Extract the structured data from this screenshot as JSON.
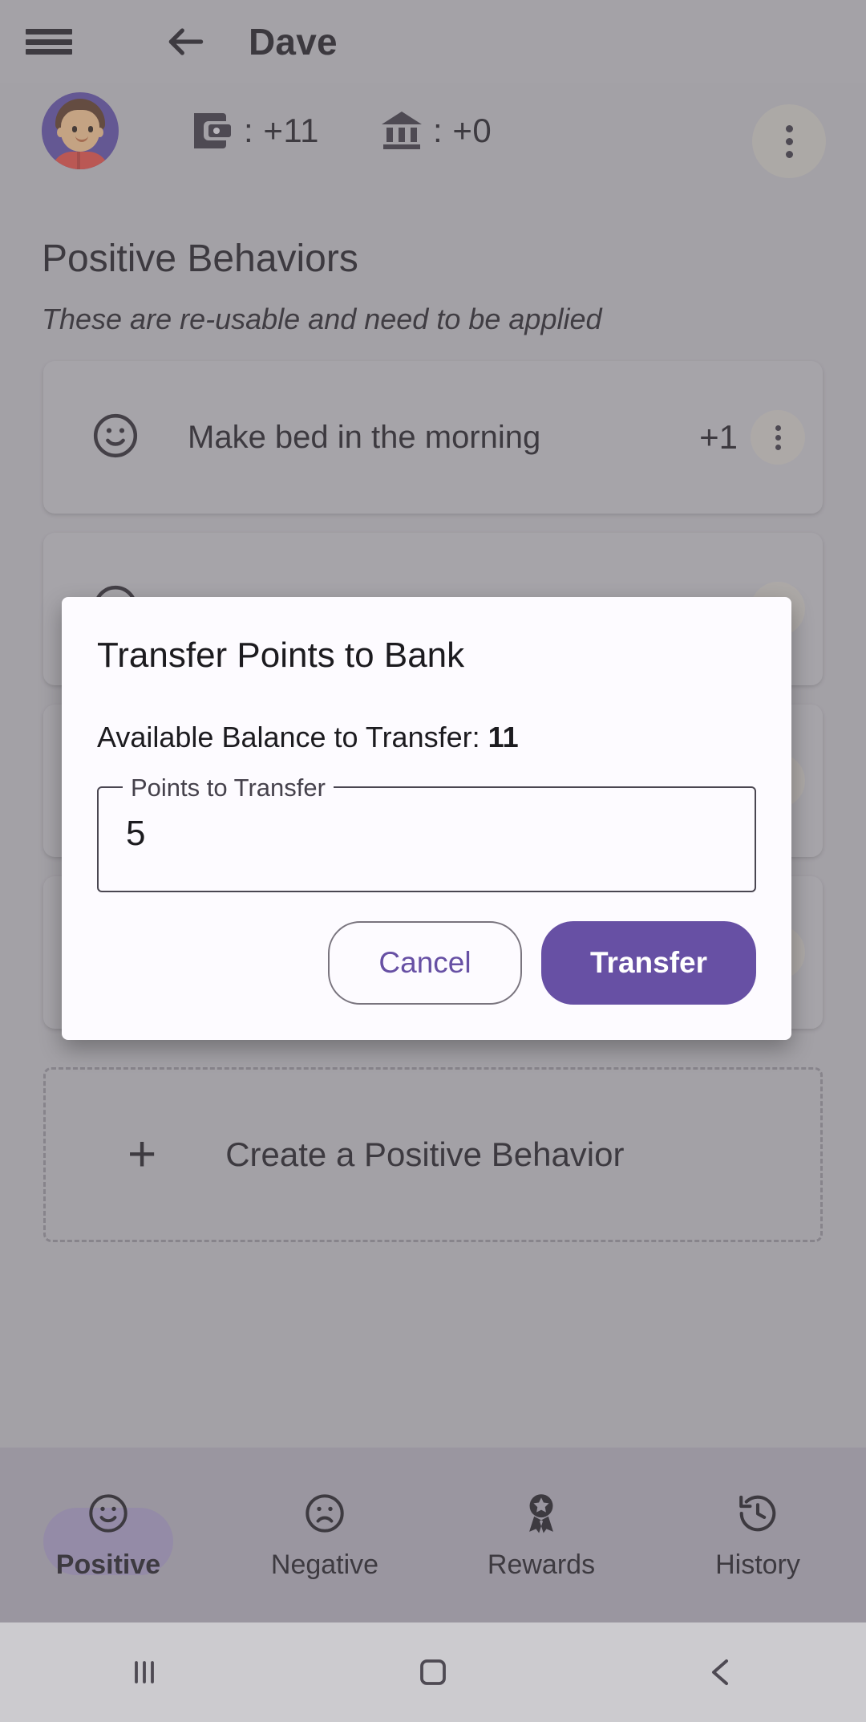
{
  "appbar": {
    "menu_icon": "hamburger-menu-icon",
    "back_icon": "arrow-left-icon",
    "title": "Dave"
  },
  "header": {
    "avatar": "user-avatar",
    "wallet": {
      "icon": "wallet-icon",
      "separator": ":",
      "value": "+11"
    },
    "bank": {
      "icon": "bank-icon",
      "separator": ":",
      "value": "+0"
    },
    "overflow_icon": "more-vertical-icon"
  },
  "section": {
    "title": "Positive Behaviors",
    "subtitle": "These are re-usable and need to be applied"
  },
  "behaviors": [
    {
      "icon": "smiley-face-icon",
      "label": "Make bed in the morning",
      "points": "+1",
      "menu": "more-vertical-icon"
    },
    {
      "icon": "smiley-face-icon",
      "label": "",
      "points": "",
      "menu": "more-vertical-icon"
    },
    {
      "icon": "smiley-face-icon",
      "label": "",
      "points": "",
      "menu": "more-vertical-icon"
    },
    {
      "icon": "smiley-face-icon",
      "label": "",
      "points": "",
      "menu": "more-vertical-icon"
    }
  ],
  "create": {
    "plus_icon": "plus-icon",
    "label": "Create a Positive Behavior"
  },
  "bottom_nav": [
    {
      "icon": "smiley-face-icon",
      "label": "Positive",
      "active": true
    },
    {
      "icon": "frowny-face-icon",
      "label": "Negative",
      "active": false
    },
    {
      "icon": "award-ribbon-icon",
      "label": "Rewards",
      "active": false
    },
    {
      "icon": "history-clock-icon",
      "label": "History",
      "active": false
    }
  ],
  "system_bar": {
    "recents_icon": "recent-apps-icon",
    "home_icon": "home-square-icon",
    "back_icon": "back-chevron-icon"
  },
  "dialog": {
    "title": "Transfer Points to Bank",
    "balance_label": "Available Balance to Transfer: ",
    "balance_value": "11",
    "field_label": "Points to Transfer",
    "field_value": "5",
    "cancel_label": "Cancel",
    "transfer_label": "Transfer"
  },
  "colors": {
    "accent": "#6750a4",
    "page_bg": "#b7b5ba",
    "card_bg": "#bcbabf",
    "dialog_bg": "#fdfbff",
    "nav_bg": "#aaa5b2",
    "text": "#1c1b1f"
  }
}
